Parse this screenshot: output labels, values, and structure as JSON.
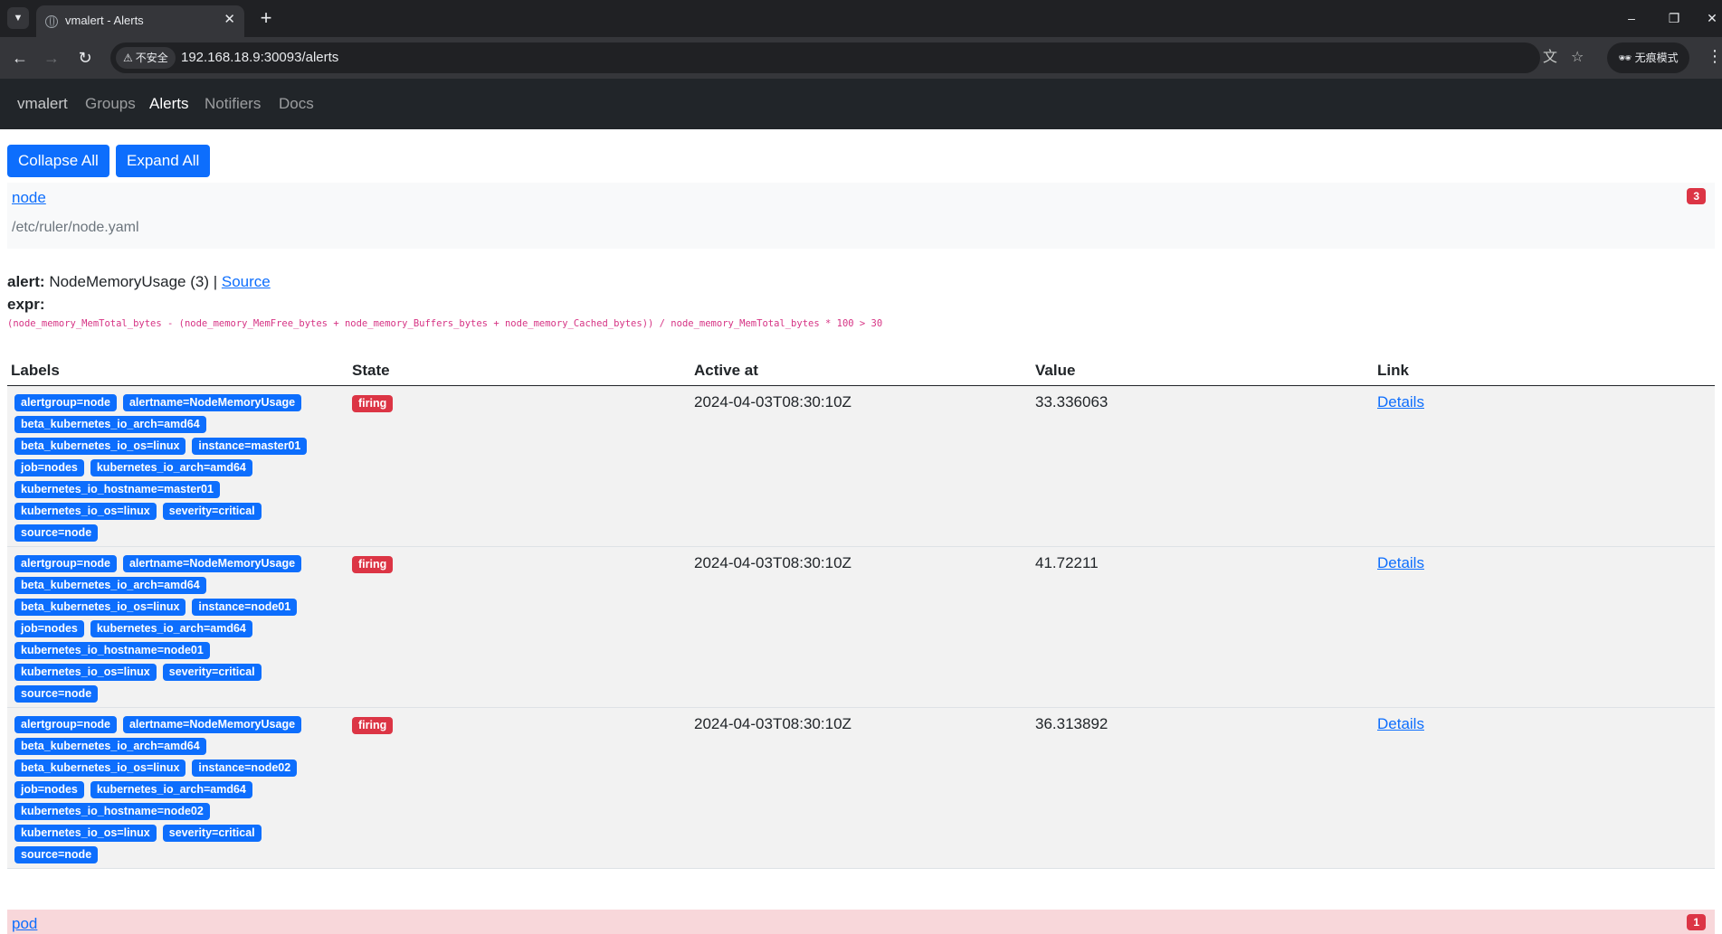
{
  "browser": {
    "tab_title": "vmalert - Alerts",
    "insecure_label": "不安全",
    "url": "192.168.18.9:30093/alerts",
    "incognito_label": "无痕模式"
  },
  "navbar": {
    "brand": "vmalert",
    "links": [
      "Groups",
      "Alerts",
      "Notifiers",
      "Docs"
    ],
    "active": "Alerts"
  },
  "buttons": {
    "collapse_all": "Collapse All",
    "expand_all": "Expand All"
  },
  "groups": [
    {
      "name": "node",
      "file": "/etc/ruler/node.yaml",
      "count": "3",
      "alert": {
        "prefix": "alert:",
        "name": "NodeMemoryUsage (3)",
        "separator": "|",
        "source_label": "Source",
        "expr_label": "expr:",
        "expr": "(node_memory_MemTotal_bytes - (node_memory_MemFree_bytes + node_memory_Buffers_bytes + node_memory_Cached_bytes)) / node_memory_MemTotal_bytes * 100 > 30",
        "columns": [
          "Labels",
          "State",
          "Active at",
          "Value",
          "Link"
        ],
        "rows": [
          {
            "labels": [
              [
                "alertgroup=node",
                "alertname=NodeMemoryUsage"
              ],
              [
                "beta_kubernetes_io_arch=amd64"
              ],
              [
                "beta_kubernetes_io_os=linux",
                "instance=master01"
              ],
              [
                "job=nodes",
                "kubernetes_io_arch=amd64"
              ],
              [
                "kubernetes_io_hostname=master01"
              ],
              [
                "kubernetes_io_os=linux",
                "severity=critical"
              ],
              [
                "source=node"
              ]
            ],
            "state": "firing",
            "active_at": "2024-04-03T08:30:10Z",
            "value": "33.336063",
            "link": "Details"
          },
          {
            "labels": [
              [
                "alertgroup=node",
                "alertname=NodeMemoryUsage"
              ],
              [
                "beta_kubernetes_io_arch=amd64"
              ],
              [
                "beta_kubernetes_io_os=linux",
                "instance=node01"
              ],
              [
                "job=nodes",
                "kubernetes_io_arch=amd64"
              ],
              [
                "kubernetes_io_hostname=node01"
              ],
              [
                "kubernetes_io_os=linux",
                "severity=critical"
              ],
              [
                "source=node"
              ]
            ],
            "state": "firing",
            "active_at": "2024-04-03T08:30:10Z",
            "value": "41.72211",
            "link": "Details"
          },
          {
            "labels": [
              [
                "alertgroup=node",
                "alertname=NodeMemoryUsage"
              ],
              [
                "beta_kubernetes_io_arch=amd64"
              ],
              [
                "beta_kubernetes_io_os=linux",
                "instance=node02"
              ],
              [
                "job=nodes",
                "kubernetes_io_arch=amd64"
              ],
              [
                "kubernetes_io_hostname=node02"
              ],
              [
                "kubernetes_io_os=linux",
                "severity=critical"
              ],
              [
                "source=node"
              ]
            ],
            "state": "firing",
            "active_at": "2024-04-03T08:30:10Z",
            "value": "36.313892",
            "link": "Details"
          }
        ]
      }
    },
    {
      "name": "pod",
      "count": "1"
    }
  ]
}
